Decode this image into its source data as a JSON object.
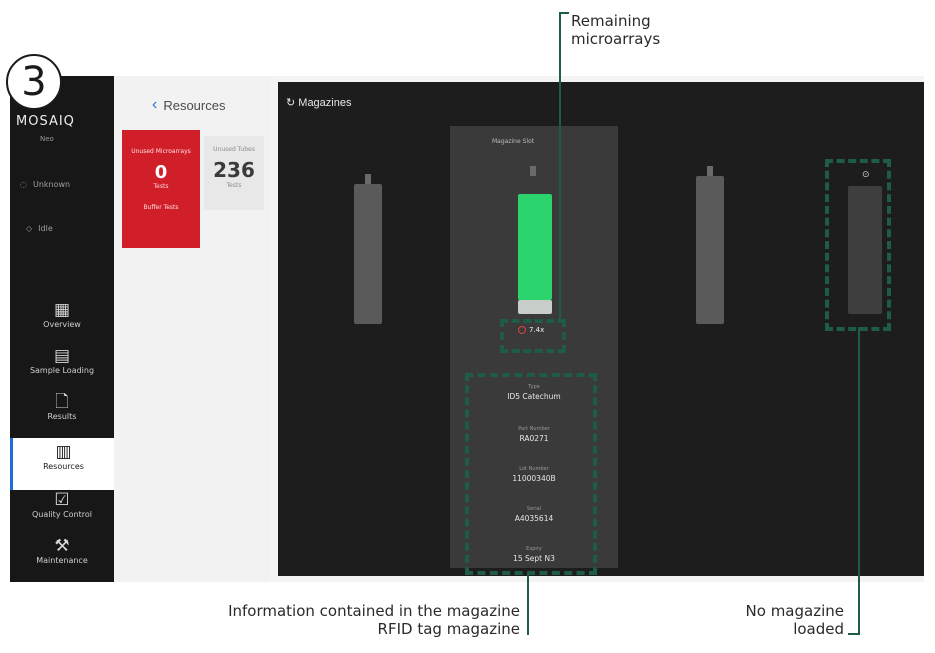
{
  "step": "3",
  "sidebar": {
    "brand": "MOSAIQ",
    "brand_sub": "Neo",
    "top_items": [
      {
        "icon": "user-icon",
        "label": "Unknown"
      },
      {
        "icon": "tag-icon",
        "label": "Idle"
      }
    ],
    "items": [
      {
        "icon": "overview-icon",
        "glyph": "▦",
        "label": "Overview"
      },
      {
        "icon": "sample-loading-icon",
        "glyph": "▤",
        "label": "Sample Loading"
      },
      {
        "icon": "results-icon",
        "glyph": "🗋",
        "label": "Results"
      },
      {
        "icon": "resources-icon",
        "glyph": "▥",
        "label": "Resources",
        "active": true
      },
      {
        "icon": "quality-control-icon",
        "glyph": "☑",
        "label": "Quality Control"
      },
      {
        "icon": "maintenance-icon",
        "glyph": "⚒",
        "label": "Maintenance"
      }
    ]
  },
  "resources": {
    "back_label": "Resources",
    "cards": [
      {
        "label": "Unused Microarrays",
        "value": "0",
        "unit": "Tests",
        "footer": "Buffer Tests",
        "color": "#d11f2a"
      },
      {
        "label": "Unused Tubes",
        "value": "236",
        "unit": "Tests"
      }
    ]
  },
  "magazines": {
    "title": "Magazines",
    "selected_header": "Magazine Slot",
    "count_label": "7.4x",
    "accent_green": "#2bd46c",
    "info": [
      {
        "key": "Type",
        "value": "ID5 Catechum"
      },
      {
        "key": "Part Number",
        "value": "RA0271"
      },
      {
        "key": "Lot Number",
        "value": "11000340B"
      },
      {
        "key": "Serial",
        "value": "A4035614"
      },
      {
        "key": "Expiry",
        "value": "15 Sept N3"
      }
    ]
  },
  "callouts": {
    "remaining": "Remaining microarrays",
    "info": "Information contained in the magazine RFID tag magazine",
    "no_magazine": "No magazine loaded",
    "line_color": "#1f5b49"
  }
}
